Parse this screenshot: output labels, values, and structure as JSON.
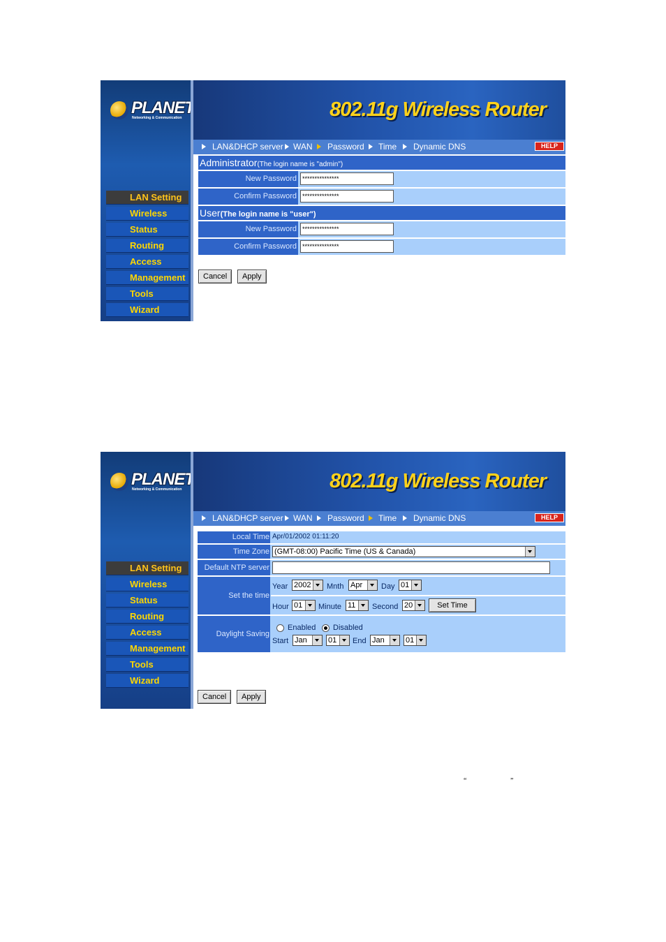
{
  "router": {
    "brand": "PLANET",
    "brand_sub": "Networking & Communication",
    "title": "802.11g Wireless Router",
    "help": "HELP",
    "menu": [
      "LAN Setting",
      "Wireless",
      "Status",
      "Routing",
      "Access",
      "Management",
      "Tools",
      "Wizard"
    ],
    "nav": [
      "LAN&DHCP server",
      "WAN",
      "Password",
      "Time",
      "Dynamic DNS"
    ]
  },
  "password_page": {
    "nav_current": "Password",
    "admin_heading": "Administrator",
    "admin_note": "(The login name is \"admin\")",
    "user_heading": "User",
    "user_note": "(The login name is \"user\")",
    "new_password_label": "New Password",
    "confirm_password_label": "Confirm Password",
    "masked_value": "***************",
    "cancel": "Cancel",
    "apply": "Apply"
  },
  "time_page": {
    "nav_current": "Time",
    "local_time_label": "Local Time",
    "local_time_value": "Apr/01/2002 01:11:20",
    "time_zone_label": "Time Zone",
    "time_zone_value": "(GMT-08:00) Pacific Time (US & Canada)",
    "ntp_label": "Default NTP server",
    "ntp_value": "",
    "set_time_label": "Set the time",
    "year_label": "Year",
    "year_value": "2002",
    "month_label": "Mnth",
    "month_value": "Apr",
    "day_label": "Day",
    "day_value": "01",
    "hour_label": "Hour",
    "hour_value": "01",
    "minute_label": "Minute",
    "minute_value": "11",
    "second_label": "Second",
    "second_value": "20",
    "set_time_button": "Set Time",
    "daylight_label": "Daylight Saving",
    "enabled_label": "Enabled",
    "disabled_label": "Disabled",
    "daylight_selected": "Disabled",
    "start_label": "Start",
    "start_month": "Jan",
    "start_day": "01",
    "end_label": "End",
    "end_month": "Jan",
    "end_day": "01",
    "cancel": "Cancel",
    "apply": "Apply"
  },
  "footer_quotes": {
    "open": "“",
    "close": "”"
  }
}
